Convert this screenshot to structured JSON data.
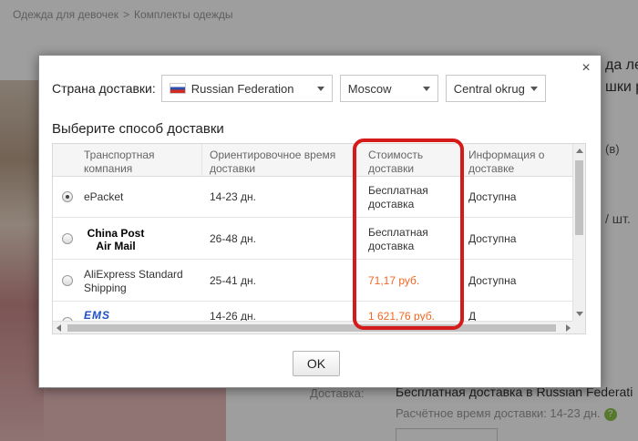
{
  "background": {
    "breadcrumb": [
      "Одежда для девочек",
      "Комплекты одежды"
    ],
    "right_title_lines": [
      "да ле",
      "шки р"
    ],
    "reviews_fragment": "(в)",
    "pieces_fragment": "/ шт.",
    "shipping_label": "Доставка:",
    "shipping_value": "Бесплатная доставка в Russian Federati",
    "shipping_time": "Расчётное время доставки: 14-23 дн.",
    "help_glyph": "?"
  },
  "dialog": {
    "close_glyph": "×",
    "country_label": "Страна доставки:",
    "country_value": "Russian Federation",
    "city_value": "Moscow",
    "district_value": "Central okrug",
    "method_title": "Выберите способ доставки",
    "columns": [
      "Транспортная компания",
      "Ориентировочное время доставки",
      "Стоимость доставки",
      "Информация о доставке"
    ],
    "rows": [
      {
        "carrier": "ePacket",
        "logo": "",
        "time": "14-23 дн.",
        "cost": "Бесплатная доставка",
        "info": "Доступна",
        "selected": true,
        "cost_color": "normal"
      },
      {
        "carrier": "China Post Air Mail",
        "logo": "China Post Air Mail",
        "time": "26-48 дн.",
        "cost": "Бесплатная доставка",
        "info": "Доступна",
        "selected": false,
        "cost_color": "normal"
      },
      {
        "carrier": "AliExpress Standard Shipping",
        "logo": "",
        "time": "25-41 дн.",
        "cost": "71,17 руб.",
        "info": "Доступна",
        "selected": false,
        "cost_color": "red"
      },
      {
        "carrier": "EMS",
        "logo": "EMS",
        "time": "14-26 дн.",
        "cost": "1 621,76 руб.",
        "info": "Д",
        "selected": false,
        "cost_color": "red"
      }
    ],
    "ok_label": "OK"
  },
  "colors": {
    "highlight": "#d41a1a",
    "price_red": "#f26722"
  }
}
